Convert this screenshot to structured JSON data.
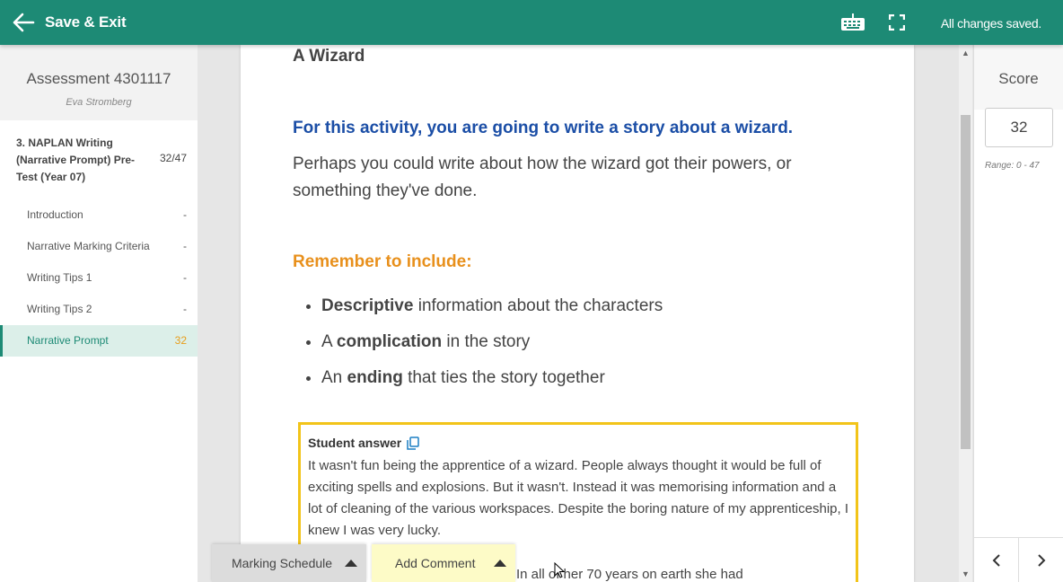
{
  "topbar": {
    "save_exit_label": "Save & Exit",
    "status_text": "All changes saved.",
    "bg_color": "#1d8a75"
  },
  "sidebar": {
    "assessment_title": "Assessment 4301117",
    "student_name": "Eva Stromberg",
    "section": {
      "title": "3. NAPLAN Writing (Narrative Prompt) Pre-Test (Year 07)",
      "score": "32/47"
    },
    "items": [
      {
        "label": "Introduction",
        "value": "-"
      },
      {
        "label": "Narrative Marking Criteria",
        "value": "-"
      },
      {
        "label": "Writing Tips 1",
        "value": "-"
      },
      {
        "label": "Writing Tips 2",
        "value": "-"
      },
      {
        "label": "Narrative Prompt",
        "value": "32"
      }
    ]
  },
  "content": {
    "title": "A Wizard",
    "activity_line": "For this activity, you are going to write a story about a wizard.",
    "paragraph": "Perhaps you could write about how the wizard got their powers, or something they've done.",
    "remember_heading": "Remember to include:",
    "bullets": [
      {
        "bold": "Descriptive",
        "rest": " information about the characters",
        "prefix": ""
      },
      {
        "prefix": "A ",
        "bold": "complication",
        "rest": " in the story"
      },
      {
        "prefix": "An ",
        "bold": "ending",
        "rest": " that ties the story together"
      }
    ],
    "answer_label": "Student answer",
    "answer_text": "It wasn't fun being the apprentice of a wizard. People always thought it would be full of exciting spells and explosions. But it wasn't. Instead it was memorising information and a lot of cleaning of the various workspaces. Despite the boring nature of my apprenticeship, I knew I was very lucky.",
    "answer_text_partial": "In all of her 70 years on earth she had"
  },
  "score_panel": {
    "heading": "Score",
    "value": "32",
    "range": "Range: 0 - 47"
  },
  "bottom_tabs": {
    "marking_schedule": "Marking Schedule",
    "add_comment": "Add Comment"
  }
}
